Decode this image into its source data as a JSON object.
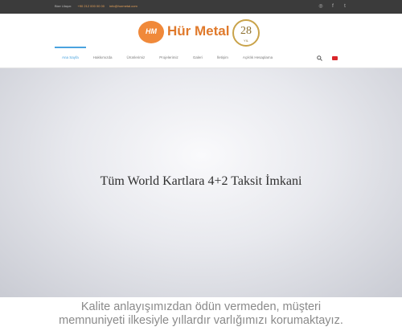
{
  "topbar": {
    "contact_label": "Bize Ulaşın:",
    "phone": "+90 212 000 00 00",
    "email": "info@hurmetal.com"
  },
  "social": [
    "instagram-icon",
    "facebook-icon",
    "twitter-icon"
  ],
  "brand": {
    "mark_text": "HM",
    "name": "Hür Metal",
    "badge_number": "28",
    "badge_caption": "YIL"
  },
  "nav": {
    "items": [
      "Ana Sayfa",
      "Hakkımızda",
      "Ürünlerimiz",
      "Projelerimiz",
      "Galeri",
      "İletişim",
      "Açıklık Hesaplama"
    ]
  },
  "hero": {
    "title": "Tüm World Kartlara 4+2 Taksit İmkani"
  },
  "intro": {
    "text": "Kalite anlayışımızdan ödün vermeden, müşteri memnuniyeti ilkesiyle yıllardır varlığımızı korumaktayız."
  },
  "colors": {
    "accent": "#4aa3df",
    "brand": "#e07a2c",
    "topbar": "#3b3b3b"
  }
}
